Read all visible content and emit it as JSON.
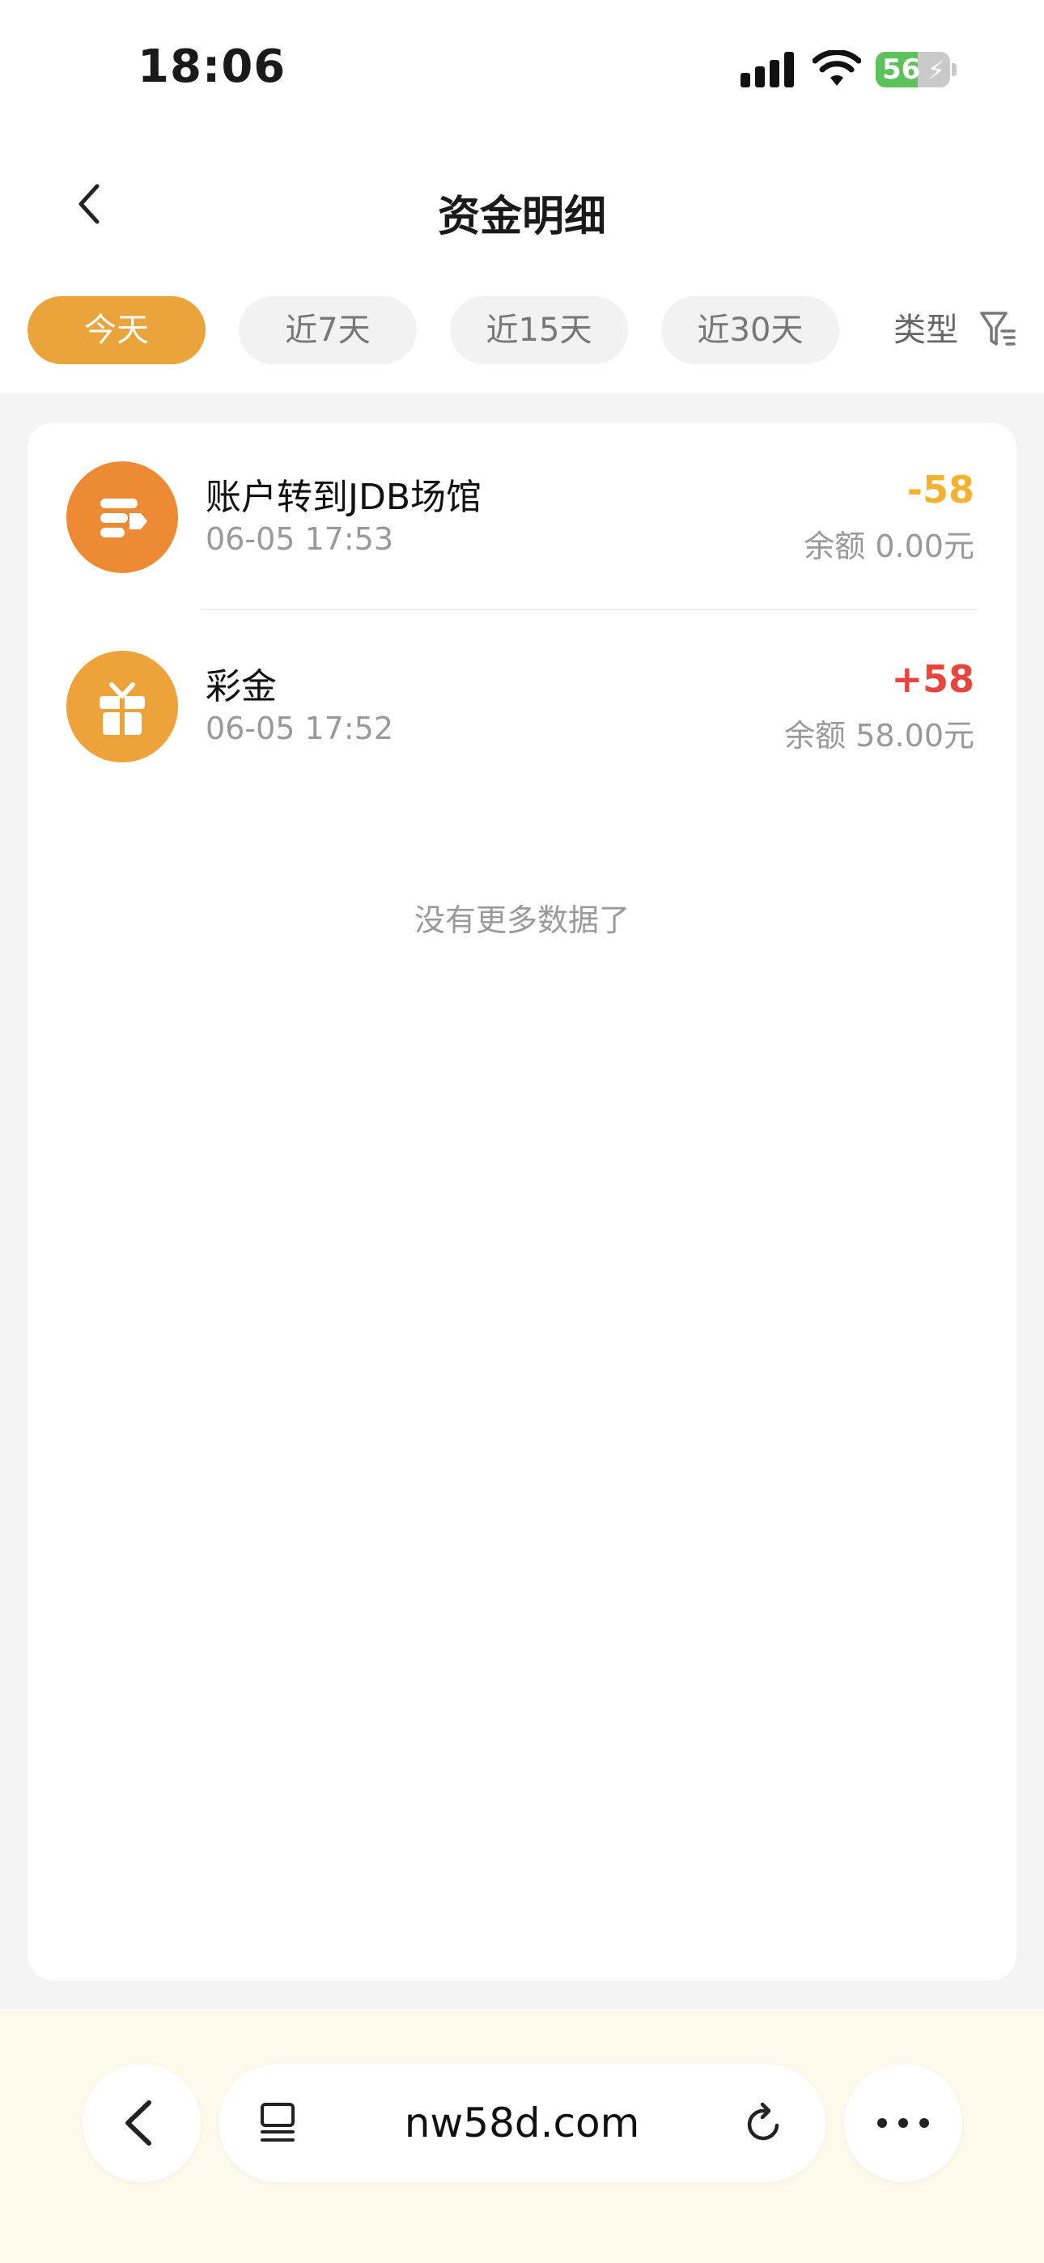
{
  "status_bar": {
    "time": "18:06",
    "battery": "56",
    "battery_level": 0.56
  },
  "header": {
    "title": "资金明细"
  },
  "tabs": [
    {
      "label": "今天",
      "active": true
    },
    {
      "label": "近7天",
      "active": false
    },
    {
      "label": "近15天",
      "active": false
    },
    {
      "label": "近30天",
      "active": false
    }
  ],
  "type_filter": {
    "label": "类型"
  },
  "transactions": [
    {
      "title": "账户转到JDB场馆",
      "time": "06-05 17:53",
      "amount": "-58",
      "balance": "余额 0.00元",
      "amount_color": "#f3b12f",
      "icon": "transfer-icon",
      "icon_color": "#ef8a34"
    },
    {
      "title": "彩金",
      "time": "06-05 17:52",
      "amount": "+58",
      "balance": "余额 58.00元",
      "amount_color": "#e8463d",
      "icon": "gift-icon",
      "icon_color": "#eea23a"
    }
  ],
  "end_note": "没有更多数据了",
  "browser": {
    "url": "nw58d.com"
  }
}
